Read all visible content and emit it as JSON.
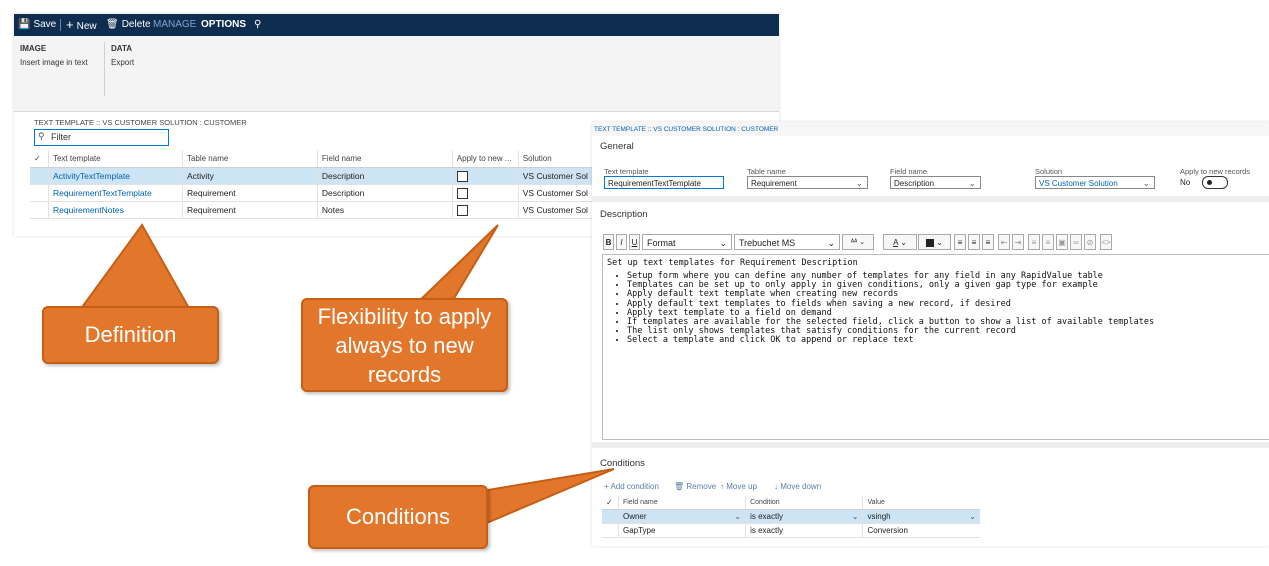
{
  "toolbar": {
    "save": "Save",
    "new": "New",
    "delete": "Delete",
    "manage_tab": "MANAGE",
    "options_tab": "OPTIONS"
  },
  "ribbon": {
    "image_group": "IMAGE",
    "image_item": "Insert image in text",
    "data_group": "DATA",
    "data_item": "Export"
  },
  "left_form": {
    "breadcrumb": "TEXT TEMPLATE :: VS CUSTOMER SOLUTION : CUSTOMER",
    "filter_placeholder": "Filter",
    "columns": [
      "Text template",
      "Table name",
      "Field name",
      "Apply to new ...",
      "Solution"
    ],
    "rows": [
      {
        "template": "ActivityTextTemplate",
        "table": "Activity",
        "field": "Description",
        "apply": false,
        "solution": "VS Customer Sol"
      },
      {
        "template": "RequirementTextTemplate",
        "table": "Requirement",
        "field": "Description",
        "apply": false,
        "solution": "VS Customer Sol"
      },
      {
        "template": "RequirementNotes",
        "table": "Requirement",
        "field": "Notes",
        "apply": false,
        "solution": "VS Customer Sol"
      }
    ]
  },
  "callouts": {
    "definition": "Definition",
    "flexibility": "Flexibility to apply always to new records",
    "conditions": "Conditions"
  },
  "right_form": {
    "breadcrumb": "TEXT TEMPLATE :: VS CUSTOMER SOLUTION : CUSTOMER",
    "general": {
      "title": "General",
      "text_template_label": "Text template",
      "text_template_value": "RequirementTextTemplate",
      "table_name_label": "Table name",
      "table_name_value": "Requirement",
      "field_name_label": "Field name",
      "field_name_value": "Description",
      "solution_label": "Solution",
      "solution_value": "VS Customer Solution",
      "apply_label": "Apply to new records",
      "apply_value": "No"
    },
    "description": {
      "title": "Description",
      "toolbar": {
        "bold": "B",
        "italic": "I",
        "underline": "U",
        "format": "Format",
        "font": "Trebuchet MS"
      },
      "first_line": "Set up text templates for Requirement Description",
      "bullets": [
        "Setup form where you can define any number of templates for any field in any RapidValue table",
        "Templates can be set up to only apply in given conditions, only a given gap type for example",
        "Apply default text template when creating new records",
        "Apply default text templates to fields when saving a new record, if desired",
        "Apply text template to a field on demand",
        "If templates are available for the selected field, click a button to show a list of available templates",
        "The list only shows templates that satisfy conditions for the current record",
        "Select a template and click OK to append or replace text"
      ]
    },
    "conditions": {
      "title": "Conditions",
      "add": "Add condition",
      "remove": "Remove",
      "move_up": "Move up",
      "move_down": "Move down",
      "columns": [
        "Field name",
        "Condition",
        "Value"
      ],
      "rows": [
        {
          "field": "Owner",
          "condition": "is exactly",
          "value": "vsingh"
        },
        {
          "field": "GapType",
          "condition": "is exactly",
          "value": "Conversion"
        }
      ]
    }
  }
}
